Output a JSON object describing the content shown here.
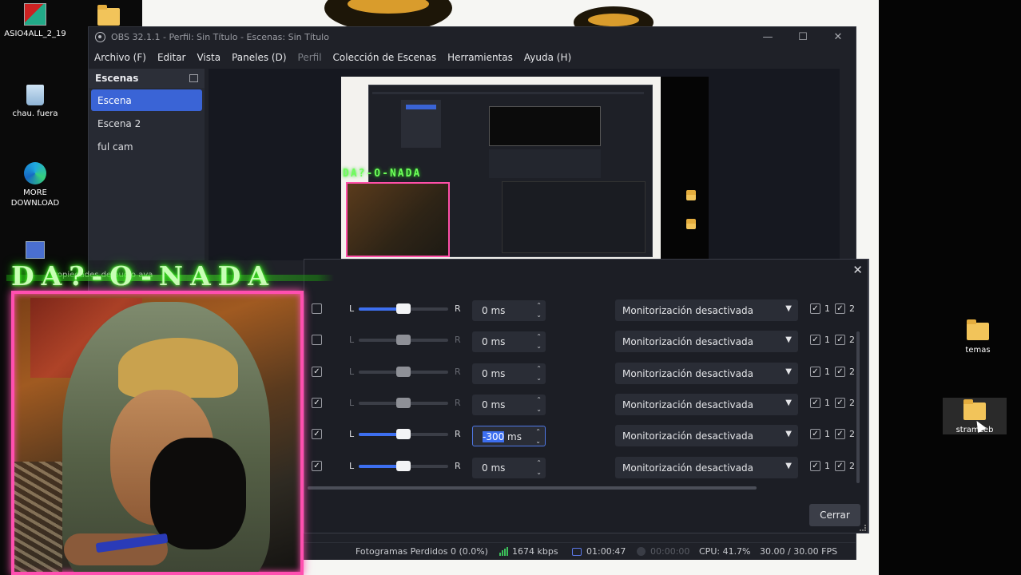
{
  "desktop": {
    "icons": [
      {
        "label": "ASIO4ALL_2_19",
        "icon": "asio-app-icon"
      },
      {
        "label": "chau. fuera",
        "icon": "recycle-bin-icon"
      },
      {
        "label": "MORE DOWNLOAD",
        "icon": "edge-icon"
      },
      {
        "label": "temas",
        "icon": "folder-icon"
      },
      {
        "label": "stramzeb",
        "icon": "folder-icon"
      }
    ]
  },
  "obs": {
    "title": "OBS 32.1.1 - Perfil: Sin Título - Escenas: Sin Título",
    "window_buttons": {
      "minimize": "—",
      "maximize": "☐",
      "close": "✕"
    },
    "menu": [
      "Archivo (F)",
      "Editar",
      "Vista",
      "Paneles (D)",
      "Perfil",
      "Colección de Escenas",
      "Herramientas",
      "Ayuda (H)"
    ],
    "scenes_header": "Escenas",
    "scenes": [
      "Escena",
      "Escena 2",
      "ful cam"
    ],
    "active_scene": "Escena",
    "status": {
      "dropped_frames": "Fotogramas Perdidos 0 (0.0%)",
      "bitrate": "1674 kbps",
      "stream_time": "01:00:47",
      "rec_time": "00:00:00",
      "cpu": "CPU: 41.7%",
      "fps": "30.00 / 30.00 FPS"
    }
  },
  "overlay": {
    "banner": "DA?-O-NADA",
    "banner_obscured_text": "ropiedades de audio ava"
  },
  "audio_dialog": {
    "close": "✕",
    "rows": [
      {
        "active": false,
        "left": "L",
        "right": "R",
        "balance": 0.5,
        "enabled": true,
        "sync": "0 ms",
        "monitoring": "Monitorización desactivada",
        "t1": "1",
        "t2": "2"
      },
      {
        "active": false,
        "left": "L",
        "right": "R",
        "balance": 0.5,
        "enabled": false,
        "sync": "0 ms",
        "monitoring": "Monitorización desactivada",
        "t1": "1",
        "t2": "2"
      },
      {
        "active": true,
        "left": "L",
        "right": "R",
        "balance": 0.5,
        "enabled": false,
        "sync": "0 ms",
        "monitoring": "Monitorización desactivada",
        "t1": "1",
        "t2": "2"
      },
      {
        "active": true,
        "left": "L",
        "right": "R",
        "balance": 0.5,
        "enabled": false,
        "sync": "0 ms",
        "monitoring": "Monitorización desactivada",
        "t1": "1",
        "t2": "2"
      },
      {
        "active": true,
        "left": "L",
        "right": "R",
        "balance": 0.5,
        "enabled": true,
        "sync_selected": "-300",
        "sync_suffix": " ms",
        "focused": true,
        "monitoring": "Monitorización desactivada",
        "t1": "1",
        "t2": "2"
      },
      {
        "active": true,
        "left": "L",
        "right": "R",
        "balance": 0.5,
        "enabled": true,
        "sync": "0 ms",
        "monitoring": "Monitorización desactivada",
        "t1": "1",
        "t2": "2"
      }
    ],
    "close_button": "Cerrar"
  }
}
